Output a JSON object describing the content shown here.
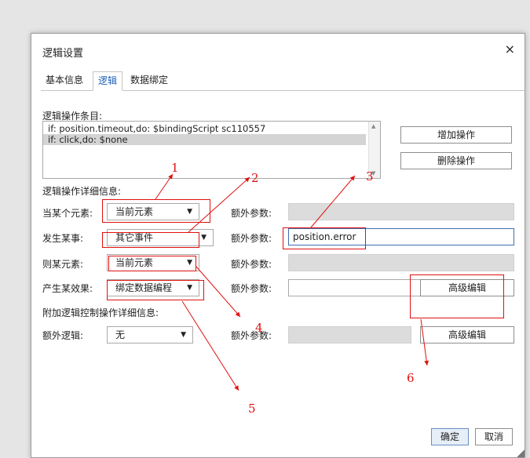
{
  "dialog": {
    "title": "逻辑设置",
    "close_glyph": "×"
  },
  "tabs": [
    {
      "label": "基本信息",
      "active": false
    },
    {
      "label": "逻辑",
      "active": true
    },
    {
      "label": "数据绑定",
      "active": false
    }
  ],
  "operations": {
    "label": "逻辑操作条目:",
    "items": [
      "if: position.timeout,do: $bindingScript sc110557",
      "if: click,do: $none"
    ],
    "add_label": "增加操作",
    "delete_label": "删除操作"
  },
  "detail": {
    "label": "逻辑操作详细信息:",
    "rows": [
      {
        "label": "当某个元素:",
        "select": "当前元素",
        "extra_label": "额外参数:",
        "extra_value": ""
      },
      {
        "label": "发生某事:",
        "select": "其它事件",
        "extra_label": "额外参数:",
        "extra_value": "position.error"
      },
      {
        "label": "则某元素:",
        "select": "当前元素",
        "extra_label": "额外参数:",
        "extra_value": ""
      },
      {
        "label": "产生某效果:",
        "select": "绑定数据编程",
        "extra_label": "额外参数:",
        "advanced_label": "高级编辑"
      }
    ]
  },
  "additional": {
    "label": "附加逻辑控制操作详细信息:",
    "row_label": "额外逻辑:",
    "select": "无",
    "extra_label": "额外参数:",
    "advanced_label": "高级编辑"
  },
  "footer": {
    "ok_label": "确定",
    "cancel_label": "取消"
  },
  "annotations": [
    "1",
    "2",
    "3",
    "4",
    "5",
    "6"
  ],
  "annotation_color": "#e01010"
}
